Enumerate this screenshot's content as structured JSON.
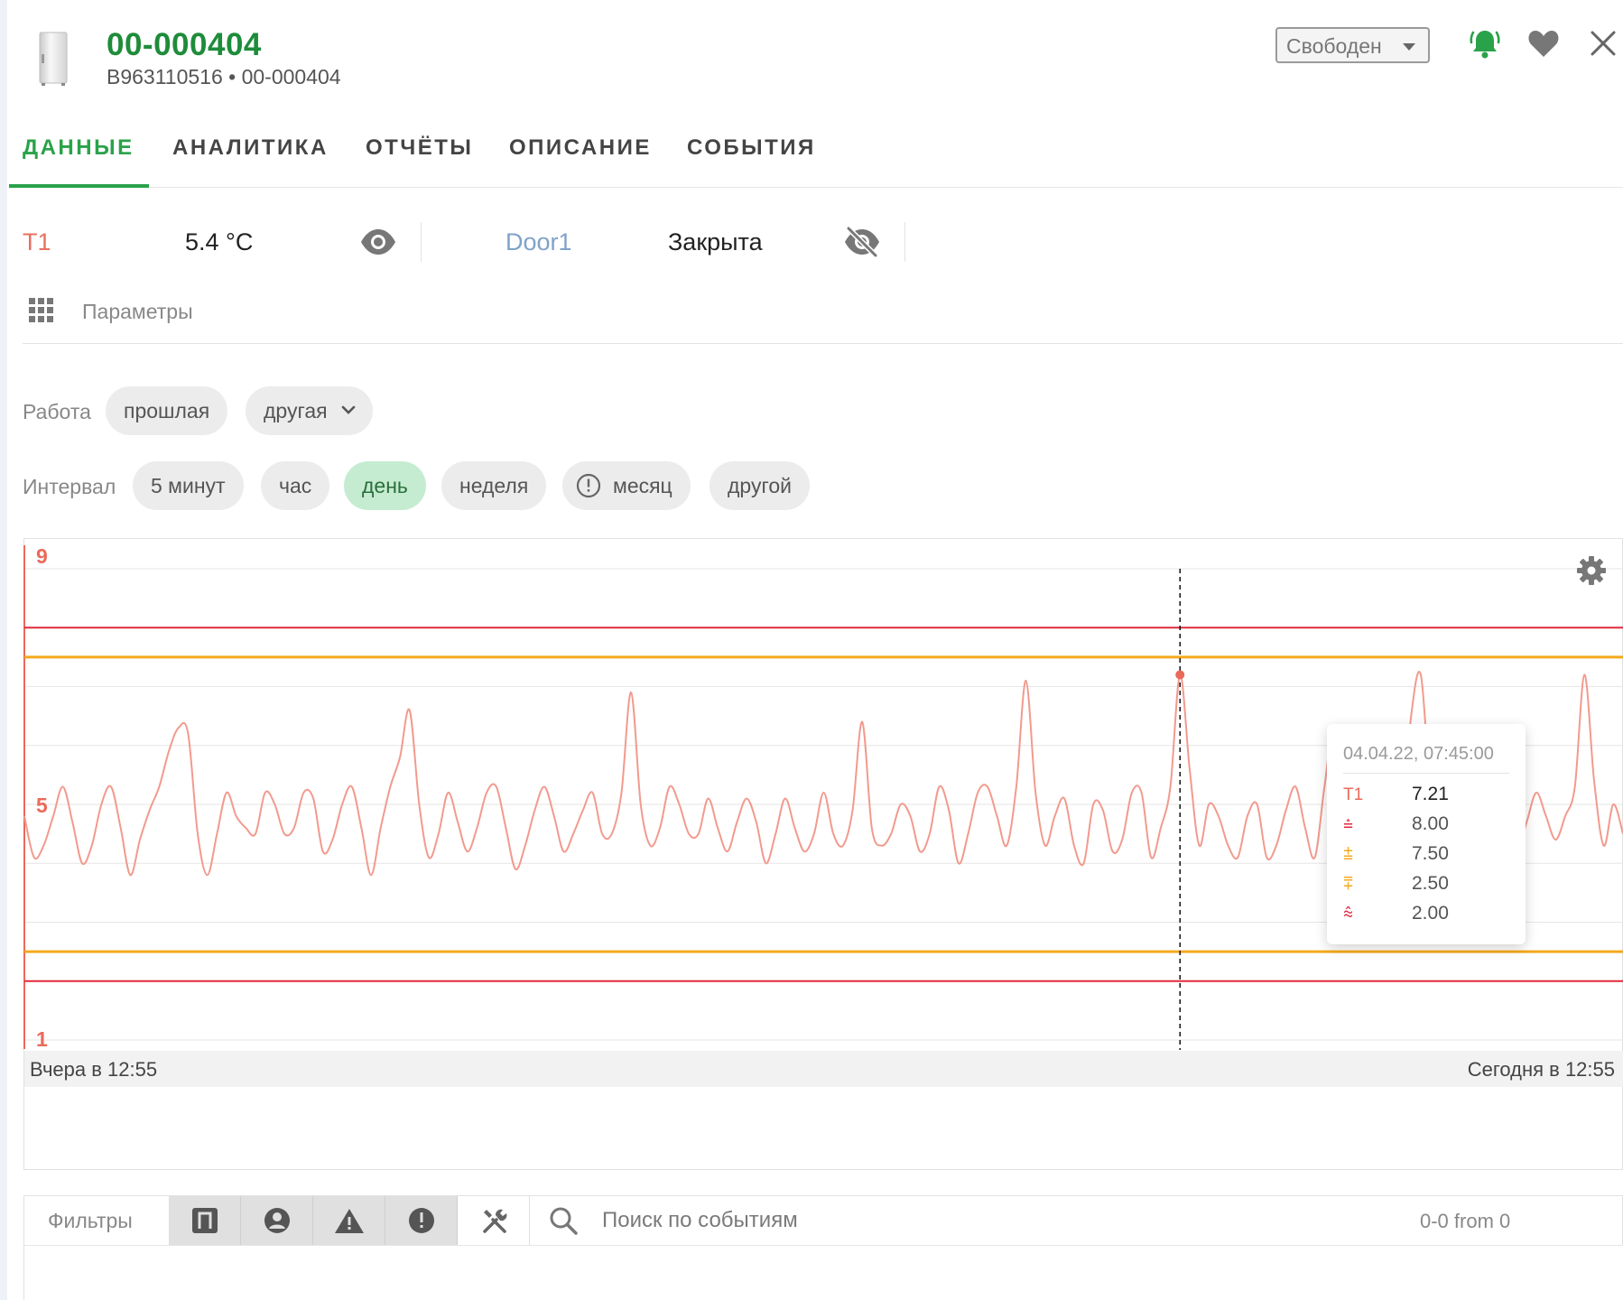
{
  "header": {
    "title": "00-000404",
    "subtitle": "B963110516 • 00-000404",
    "status_value": "Свободен"
  },
  "tabs": [
    {
      "label": "ДАННЫЕ",
      "active": true
    },
    {
      "label": "АНАЛИТИКА",
      "active": false
    },
    {
      "label": "ОТЧЁТЫ",
      "active": false
    },
    {
      "label": "ОПИСАНИЕ",
      "active": false
    },
    {
      "label": "СОБЫТИЯ",
      "active": false
    }
  ],
  "sensors": [
    {
      "name": "T1",
      "value": "5.4 °C",
      "name_color": "#e8705f",
      "visible": true
    },
    {
      "name": "Door1",
      "value": "Закрыта",
      "name_color": "#7fa3c8",
      "visible": false
    }
  ],
  "params_label": "Параметры",
  "work": {
    "label": "Работа",
    "options": [
      "прошлая",
      "другая"
    ]
  },
  "interval": {
    "label": "Интервал",
    "options": [
      "5 минут",
      "час",
      "день",
      "неделя",
      "месяц",
      "другой"
    ],
    "selected": "день"
  },
  "colors": {
    "accent": "#2aa24a",
    "series": "#f29a8e",
    "limit_red": "#e0283c",
    "limit_orange": "#f5a91c",
    "axis": "#ea6a5a"
  },
  "chart_data": {
    "type": "line",
    "ylim": [
      1,
      9
    ],
    "ytick_labels": [
      "9",
      "5",
      "1"
    ],
    "x_start_label": "Вчера в 12:55",
    "x_end_label": "Сегодня в 12:55",
    "limits": {
      "upper_alarm": 8.0,
      "upper_warning": 7.5,
      "lower_warning": 2.5,
      "lower_alarm": 2.0
    },
    "series": [
      {
        "name": "T1",
        "values": [
          4.8,
          4.1,
          4.3,
          4.8,
          5.3,
          4.7,
          4.0,
          4.3,
          5.0,
          5.3,
          4.6,
          3.8,
          4.4,
          4.9,
          5.3,
          5.9,
          6.3,
          6.2,
          4.5,
          3.8,
          4.5,
          5.2,
          4.8,
          4.6,
          4.5,
          5.2,
          5.0,
          4.5,
          4.6,
          5.2,
          5.1,
          4.2,
          4.4,
          5.0,
          5.3,
          4.6,
          3.8,
          4.6,
          5.3,
          5.8,
          6.6,
          5.0,
          4.1,
          4.5,
          5.2,
          4.7,
          4.2,
          4.6,
          5.2,
          5.3,
          4.6,
          3.9,
          4.3,
          4.9,
          5.3,
          4.8,
          4.2,
          4.5,
          4.9,
          5.2,
          4.5,
          4.5,
          5.2,
          6.9,
          5.0,
          4.3,
          4.6,
          5.3,
          5.0,
          4.5,
          4.5,
          5.1,
          4.6,
          4.2,
          4.7,
          5.1,
          4.7,
          4.0,
          4.5,
          5.1,
          4.6,
          4.2,
          4.5,
          5.2,
          4.5,
          4.3,
          4.9,
          6.4,
          4.6,
          4.3,
          4.5,
          5.0,
          4.8,
          4.2,
          4.5,
          5.3,
          4.9,
          4.0,
          4.5,
          5.2,
          5.3,
          4.8,
          4.3,
          5.3,
          7.1,
          5.2,
          4.3,
          4.8,
          5.1,
          4.3,
          4.0,
          5.0,
          4.9,
          4.2,
          4.4,
          5.2,
          5.2,
          4.1,
          4.6,
          5.3,
          7.2,
          5.6,
          4.3,
          5.0,
          4.8,
          4.3,
          4.1,
          4.8,
          5.0,
          4.1,
          4.3,
          4.9,
          5.3,
          4.6,
          4.1,
          5.3,
          6.3,
          5.0,
          4.3,
          5.0,
          5.3,
          4.7,
          4.2,
          4.6,
          6.5,
          7.2,
          5.2,
          4.2,
          4.6,
          5.2,
          4.9,
          4.4,
          4.6,
          5.0,
          4.7,
          4.2,
          4.7,
          5.2,
          4.8,
          4.4,
          4.8,
          5.3,
          7.2,
          5.4,
          4.3,
          5.0,
          4.5
        ]
      }
    ],
    "tooltip": {
      "time": "04.04.22, 07:45:00",
      "rows": [
        {
          "key": "T1",
          "value": "7.21",
          "color": "#ea6a5a"
        },
        {
          "key": "⩮",
          "value": "8.00",
          "color": "#e0283c"
        },
        {
          "key": "⩲",
          "value": "7.50",
          "color": "#f5a91c"
        },
        {
          "key": "⩱",
          "value": "2.50",
          "color": "#f5a91c"
        },
        {
          "key": "⩯",
          "value": "2.00",
          "color": "#e0283c"
        }
      ]
    }
  },
  "filters": {
    "label": "Фильтры",
    "search_placeholder": "Поиск по событиям",
    "count_text": "0-0 from 0"
  }
}
